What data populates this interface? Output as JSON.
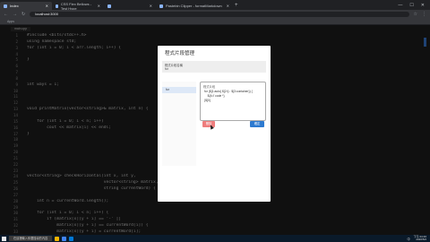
{
  "browser": {
    "tabs": [
      {
        "label": "Index",
        "active": true
      },
      {
        "label": "CSS Flex Bellows - Test Hype",
        "active": false
      },
      {
        "label": "",
        "active": false
      },
      {
        "label": "Pastebin Clipper - formatMarkdown",
        "active": false
      }
    ],
    "url": "localhost:3000",
    "bookmarks": [
      "Apps",
      "",
      "",
      "",
      ""
    ]
  },
  "editor": {
    "tab": "main.cpp",
    "line_numbers": [
      "1",
      "2",
      "3",
      "4",
      "5",
      "6",
      "7",
      "8",
      "9",
      "10",
      "11",
      "12",
      "13",
      "14",
      "15",
      "16",
      "17",
      "18",
      "19",
      "20",
      "21",
      "22",
      "23",
      "24",
      "25",
      "26",
      "27",
      "28",
      "29",
      "30",
      "31",
      "32",
      "33"
    ],
    "lines": [
      {
        "text": "#include <bits/stdc++.h>",
        "dim": false
      },
      {
        "text": "using namespace std;",
        "dim": false
      },
      {
        "text": "for (int i = 0; i < arr.length; i++) {",
        "dim": false
      },
      {
        "text": "",
        "dim": false
      },
      {
        "text": "}",
        "dim": false
      },
      {
        "text": "",
        "dim": false
      },
      {
        "text": "",
        "dim": true
      },
      {
        "text": "",
        "dim": true
      },
      {
        "text": "int ways = 1;",
        "dim": false
      },
      {
        "text": "",
        "dim": false
      },
      {
        "text": "",
        "dim": true
      },
      {
        "text": "",
        "dim": true
      },
      {
        "text": "void printMatrix(vector<string>& matrix, int n) {",
        "dim": false
      },
      {
        "text": "",
        "dim": false
      },
      {
        "text": "    for (int i = 0; i < n; i++)",
        "dim": false
      },
      {
        "text": "        cout << matrix[i] << endl;",
        "dim": false
      },
      {
        "text": "}",
        "dim": false
      },
      {
        "text": "",
        "dim": false
      },
      {
        "text": "",
        "dim": true
      },
      {
        "text": "",
        "dim": true
      },
      {
        "text": "",
        "dim": true
      },
      {
        "text": "",
        "dim": true
      },
      {
        "text": "",
        "dim": true
      },
      {
        "text": "vector<string> checkHorizontal(int x, int y,",
        "dim": false
      },
      {
        "text": "                               vector<string> matrix,",
        "dim": false
      },
      {
        "text": "                               string currentWord) {",
        "dim": false
      },
      {
        "text": "",
        "dim": false
      },
      {
        "text": "    int n = currentWord.length();",
        "dim": false
      },
      {
        "text": "",
        "dim": false
      },
      {
        "text": "    for (int i = 0; i < n; i++) {",
        "dim": false
      },
      {
        "text": "        if (matrix[x][y + i] == '-' ||",
        "dim": false
      },
      {
        "text": "            matrix[x][y + i] == currentWord[i]) {",
        "dim": false
      },
      {
        "text": "            matrix[x][y + i] = currentWord[i];",
        "dim": false
      }
    ]
  },
  "modal": {
    "title": "程式片段管理",
    "setting_label": "程式片段名稱",
    "setting_value": "for",
    "side_item": "for",
    "box_label": "程式片段",
    "snippet_lines": [
      "for (${1:auto} ${2:i} : ${3:container}) {",
      "    ${4:// code *}",
      "}${0}"
    ],
    "delete_label": "刪除",
    "confirm_label": "確定"
  },
  "taskbar": {
    "search_placeholder": "在這裡輸入你要搜尋的內容",
    "tray_lang": "中",
    "time": "下午 04:46",
    "date": "2020/5/2"
  },
  "colors": {
    "accent": "#2d7ad0",
    "danger": "#ef7d7d",
    "editor_bg": "#1e1e1e"
  }
}
